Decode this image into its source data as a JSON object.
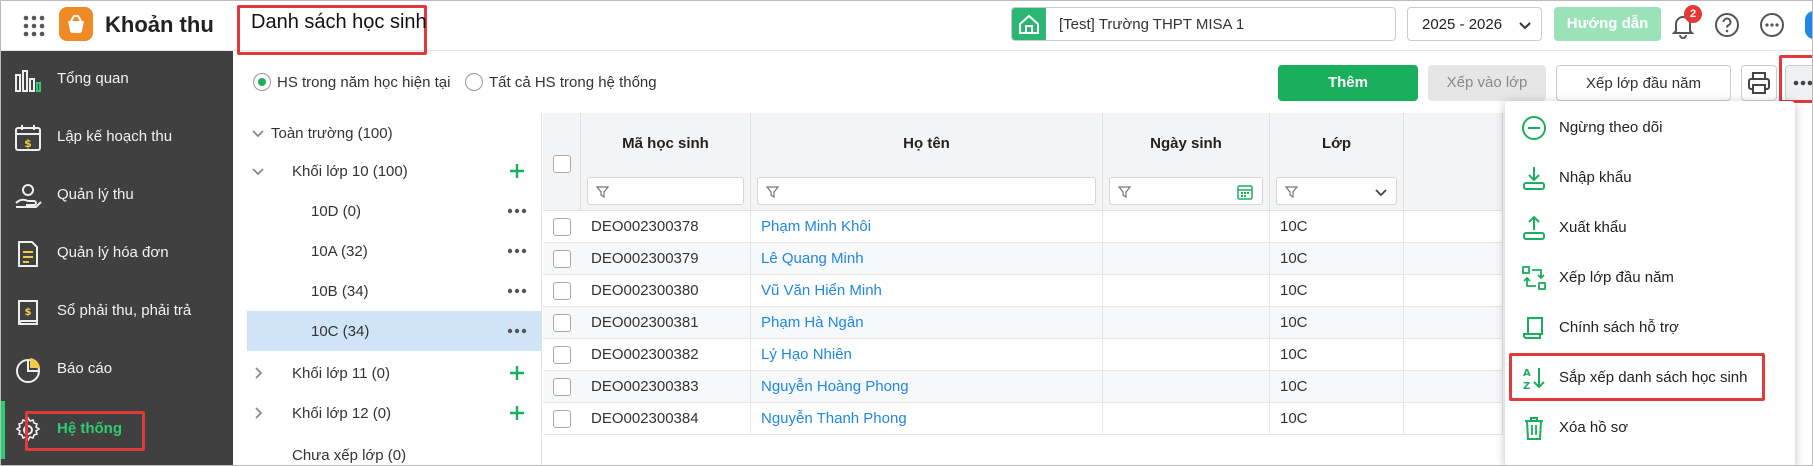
{
  "header": {
    "app_name": "Khoản thu",
    "page_title": "Danh sách học sinh",
    "school": "[Test] Trường THPT MISA 1",
    "school_year": "2025 - 2026",
    "guide_label": "Hướng dẫn",
    "notification_count": "2"
  },
  "sidebar": {
    "items": [
      {
        "label": "Tổng quan",
        "icon": "dashboard-chart-icon"
      },
      {
        "label": "Lập kế hoạch thu",
        "icon": "calendar-money-icon"
      },
      {
        "label": "Quản lý thu",
        "icon": "hand-coin-icon"
      },
      {
        "label": "Quản lý hóa đơn",
        "icon": "invoice-icon"
      },
      {
        "label": "Sổ phải thu, phải trả",
        "icon": "ledger-book-icon"
      },
      {
        "label": "Báo cáo",
        "icon": "pie-chart-icon"
      },
      {
        "label": "Hệ thống",
        "icon": "gear-icon",
        "active": true
      }
    ]
  },
  "toolbar": {
    "radio_current": "HS trong năm học hiện tại",
    "radio_all": "Tất cả HS trong hệ thống",
    "add_label": "Thêm",
    "assign_label": "Xếp vào lớp",
    "arrange_label": "Xếp lớp đầu năm"
  },
  "tree": {
    "nodes": [
      {
        "label": "Toàn trường (100)",
        "level": 0,
        "expanded": true
      },
      {
        "label": "Khối lớp 10  (100)",
        "level": 1,
        "expanded": true,
        "add": true
      },
      {
        "label": "10D  (0)",
        "level": 2
      },
      {
        "label": "10A  (32)",
        "level": 2
      },
      {
        "label": "10B  (34)",
        "level": 2
      },
      {
        "label": "10C  (34)",
        "level": 2,
        "selected": true
      },
      {
        "label": "Khối lớp 11  (0)",
        "level": 1,
        "expanded": false,
        "add": true
      },
      {
        "label": "Khối lớp 12  (0)",
        "level": 1,
        "expanded": false,
        "add": true
      },
      {
        "label": "Chưa xếp lớp  (0)",
        "level": 1
      }
    ]
  },
  "table": {
    "columns": [
      "Mã học sinh",
      "Họ tên",
      "Ngày sinh",
      "Lớp"
    ],
    "rows": [
      {
        "code": "DEO002300378",
        "name": "Phạm Minh Khôi",
        "dob": "",
        "class": "10C"
      },
      {
        "code": "DEO002300379",
        "name": "Lê Quang Minh",
        "dob": "",
        "class": "10C"
      },
      {
        "code": "DEO002300380",
        "name": "Vũ Văn Hiển Minh",
        "dob": "",
        "class": "10C"
      },
      {
        "code": "DEO002300381",
        "name": "Phạm Hà Ngân",
        "dob": "",
        "class": "10C"
      },
      {
        "code": "DEO002300382",
        "name": "Lý Hạo Nhiên",
        "dob": "",
        "class": "10C"
      },
      {
        "code": "DEO002300383",
        "name": "Nguyễn Hoàng Phong",
        "dob": "",
        "class": "10C"
      },
      {
        "code": "DEO002300384",
        "name": "Nguyễn Thanh Phong",
        "dob": "",
        "class": "10C"
      }
    ]
  },
  "menu": {
    "items": [
      {
        "label": "Ngừng theo dõi",
        "icon": "minus-circle-icon"
      },
      {
        "label": "Nhập khẩu",
        "icon": "import-icon"
      },
      {
        "label": "Xuất khẩu",
        "icon": "export-icon"
      },
      {
        "label": "Xếp lớp đầu năm",
        "icon": "swap-arrange-icon"
      },
      {
        "label": "Chính sách hỗ trợ",
        "icon": "scroll-policy-icon"
      },
      {
        "label": "Sắp xếp danh sách học sinh",
        "icon": "sort-az-icon"
      },
      {
        "label": "Xóa hồ sơ",
        "icon": "trash-icon"
      }
    ]
  },
  "colors": {
    "accent": "#1aaf5d",
    "sidebar": "#404040",
    "link": "#1e88e5",
    "highlight": "#e03a3a"
  }
}
